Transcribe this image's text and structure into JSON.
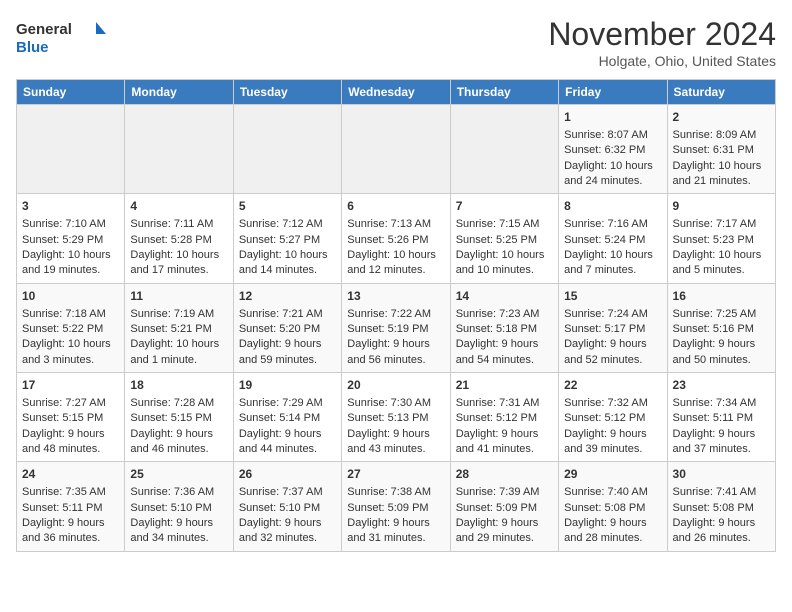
{
  "logo": {
    "line1": "General",
    "line2": "Blue"
  },
  "title": "November 2024",
  "subtitle": "Holgate, Ohio, United States",
  "days_header": [
    "Sunday",
    "Monday",
    "Tuesday",
    "Wednesday",
    "Thursday",
    "Friday",
    "Saturday"
  ],
  "weeks": [
    [
      {
        "day": "",
        "empty": true
      },
      {
        "day": "",
        "empty": true
      },
      {
        "day": "",
        "empty": true
      },
      {
        "day": "",
        "empty": true
      },
      {
        "day": "",
        "empty": true
      },
      {
        "day": "1",
        "sunrise": "Sunrise: 8:07 AM",
        "sunset": "Sunset: 6:32 PM",
        "daylight": "Daylight: 10 hours and 24 minutes."
      },
      {
        "day": "2",
        "sunrise": "Sunrise: 8:09 AM",
        "sunset": "Sunset: 6:31 PM",
        "daylight": "Daylight: 10 hours and 21 minutes."
      }
    ],
    [
      {
        "day": "3",
        "sunrise": "Sunrise: 7:10 AM",
        "sunset": "Sunset: 5:29 PM",
        "daylight": "Daylight: 10 hours and 19 minutes."
      },
      {
        "day": "4",
        "sunrise": "Sunrise: 7:11 AM",
        "sunset": "Sunset: 5:28 PM",
        "daylight": "Daylight: 10 hours and 17 minutes."
      },
      {
        "day": "5",
        "sunrise": "Sunrise: 7:12 AM",
        "sunset": "Sunset: 5:27 PM",
        "daylight": "Daylight: 10 hours and 14 minutes."
      },
      {
        "day": "6",
        "sunrise": "Sunrise: 7:13 AM",
        "sunset": "Sunset: 5:26 PM",
        "daylight": "Daylight: 10 hours and 12 minutes."
      },
      {
        "day": "7",
        "sunrise": "Sunrise: 7:15 AM",
        "sunset": "Sunset: 5:25 PM",
        "daylight": "Daylight: 10 hours and 10 minutes."
      },
      {
        "day": "8",
        "sunrise": "Sunrise: 7:16 AM",
        "sunset": "Sunset: 5:24 PM",
        "daylight": "Daylight: 10 hours and 7 minutes."
      },
      {
        "day": "9",
        "sunrise": "Sunrise: 7:17 AM",
        "sunset": "Sunset: 5:23 PM",
        "daylight": "Daylight: 10 hours and 5 minutes."
      }
    ],
    [
      {
        "day": "10",
        "sunrise": "Sunrise: 7:18 AM",
        "sunset": "Sunset: 5:22 PM",
        "daylight": "Daylight: 10 hours and 3 minutes."
      },
      {
        "day": "11",
        "sunrise": "Sunrise: 7:19 AM",
        "sunset": "Sunset: 5:21 PM",
        "daylight": "Daylight: 10 hours and 1 minute."
      },
      {
        "day": "12",
        "sunrise": "Sunrise: 7:21 AM",
        "sunset": "Sunset: 5:20 PM",
        "daylight": "Daylight: 9 hours and 59 minutes."
      },
      {
        "day": "13",
        "sunrise": "Sunrise: 7:22 AM",
        "sunset": "Sunset: 5:19 PM",
        "daylight": "Daylight: 9 hours and 56 minutes."
      },
      {
        "day": "14",
        "sunrise": "Sunrise: 7:23 AM",
        "sunset": "Sunset: 5:18 PM",
        "daylight": "Daylight: 9 hours and 54 minutes."
      },
      {
        "day": "15",
        "sunrise": "Sunrise: 7:24 AM",
        "sunset": "Sunset: 5:17 PM",
        "daylight": "Daylight: 9 hours and 52 minutes."
      },
      {
        "day": "16",
        "sunrise": "Sunrise: 7:25 AM",
        "sunset": "Sunset: 5:16 PM",
        "daylight": "Daylight: 9 hours and 50 minutes."
      }
    ],
    [
      {
        "day": "17",
        "sunrise": "Sunrise: 7:27 AM",
        "sunset": "Sunset: 5:15 PM",
        "daylight": "Daylight: 9 hours and 48 minutes."
      },
      {
        "day": "18",
        "sunrise": "Sunrise: 7:28 AM",
        "sunset": "Sunset: 5:15 PM",
        "daylight": "Daylight: 9 hours and 46 minutes."
      },
      {
        "day": "19",
        "sunrise": "Sunrise: 7:29 AM",
        "sunset": "Sunset: 5:14 PM",
        "daylight": "Daylight: 9 hours and 44 minutes."
      },
      {
        "day": "20",
        "sunrise": "Sunrise: 7:30 AM",
        "sunset": "Sunset: 5:13 PM",
        "daylight": "Daylight: 9 hours and 43 minutes."
      },
      {
        "day": "21",
        "sunrise": "Sunrise: 7:31 AM",
        "sunset": "Sunset: 5:12 PM",
        "daylight": "Daylight: 9 hours and 41 minutes."
      },
      {
        "day": "22",
        "sunrise": "Sunrise: 7:32 AM",
        "sunset": "Sunset: 5:12 PM",
        "daylight": "Daylight: 9 hours and 39 minutes."
      },
      {
        "day": "23",
        "sunrise": "Sunrise: 7:34 AM",
        "sunset": "Sunset: 5:11 PM",
        "daylight": "Daylight: 9 hours and 37 minutes."
      }
    ],
    [
      {
        "day": "24",
        "sunrise": "Sunrise: 7:35 AM",
        "sunset": "Sunset: 5:11 PM",
        "daylight": "Daylight: 9 hours and 36 minutes."
      },
      {
        "day": "25",
        "sunrise": "Sunrise: 7:36 AM",
        "sunset": "Sunset: 5:10 PM",
        "daylight": "Daylight: 9 hours and 34 minutes."
      },
      {
        "day": "26",
        "sunrise": "Sunrise: 7:37 AM",
        "sunset": "Sunset: 5:10 PM",
        "daylight": "Daylight: 9 hours and 32 minutes."
      },
      {
        "day": "27",
        "sunrise": "Sunrise: 7:38 AM",
        "sunset": "Sunset: 5:09 PM",
        "daylight": "Daylight: 9 hours and 31 minutes."
      },
      {
        "day": "28",
        "sunrise": "Sunrise: 7:39 AM",
        "sunset": "Sunset: 5:09 PM",
        "daylight": "Daylight: 9 hours and 29 minutes."
      },
      {
        "day": "29",
        "sunrise": "Sunrise: 7:40 AM",
        "sunset": "Sunset: 5:08 PM",
        "daylight": "Daylight: 9 hours and 28 minutes."
      },
      {
        "day": "30",
        "sunrise": "Sunrise: 7:41 AM",
        "sunset": "Sunset: 5:08 PM",
        "daylight": "Daylight: 9 hours and 26 minutes."
      }
    ]
  ]
}
